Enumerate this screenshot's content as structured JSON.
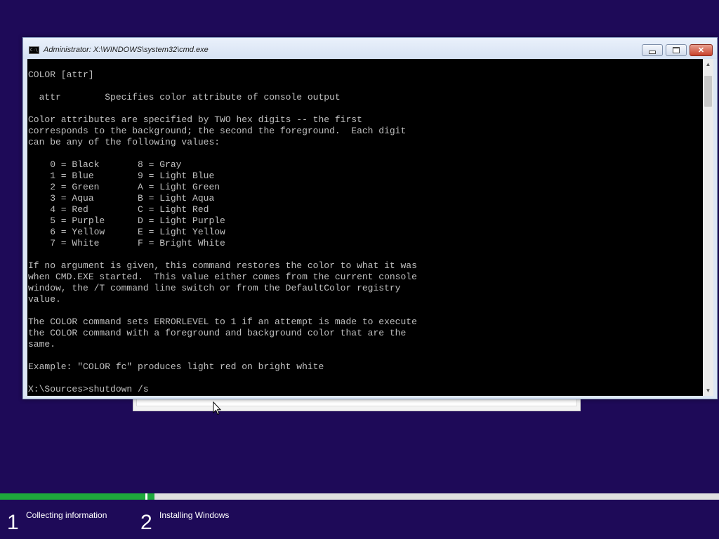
{
  "window": {
    "title": "Administrator: X:\\WINDOWS\\system32\\cmd.exe",
    "icon_label": "C:\\",
    "close_glyph": "✕"
  },
  "console": {
    "lines": [
      "COLOR [attr]",
      "",
      "  attr        Specifies color attribute of console output",
      "",
      "Color attributes are specified by TWO hex digits -- the first",
      "corresponds to the background; the second the foreground.  Each digit",
      "can be any of the following values:",
      "",
      "    0 = Black       8 = Gray",
      "    1 = Blue        9 = Light Blue",
      "    2 = Green       A = Light Green",
      "    3 = Aqua        B = Light Aqua",
      "    4 = Red         C = Light Red",
      "    5 = Purple      D = Light Purple",
      "    6 = Yellow      E = Light Yellow",
      "    7 = White       F = Bright White",
      "",
      "If no argument is given, this command restores the color to what it was",
      "when CMD.EXE started.  This value either comes from the current console",
      "window, the /T command line switch or from the DefaultColor registry",
      "value.",
      "",
      "The COLOR command sets ERRORLEVEL to 1 if an attempt is made to execute",
      "the COLOR command with a foreground and background color that are the",
      "same.",
      "",
      "Example: \"COLOR fc\" produces light red on bright white",
      "",
      "X:\\Sources>shutdown /s"
    ]
  },
  "scrollbar": {
    "up_glyph": "▲",
    "down_glyph": "▼"
  },
  "progress": {
    "fill_fraction": 0.202,
    "color": "#1ea83c"
  },
  "steps": [
    {
      "number": "1",
      "label": "Collecting information"
    },
    {
      "number": "2",
      "label": "Installing Windows"
    }
  ],
  "colors": {
    "desktop": "#1e0a58",
    "console_bg": "#000000",
    "console_fg": "#c0c0c0"
  }
}
